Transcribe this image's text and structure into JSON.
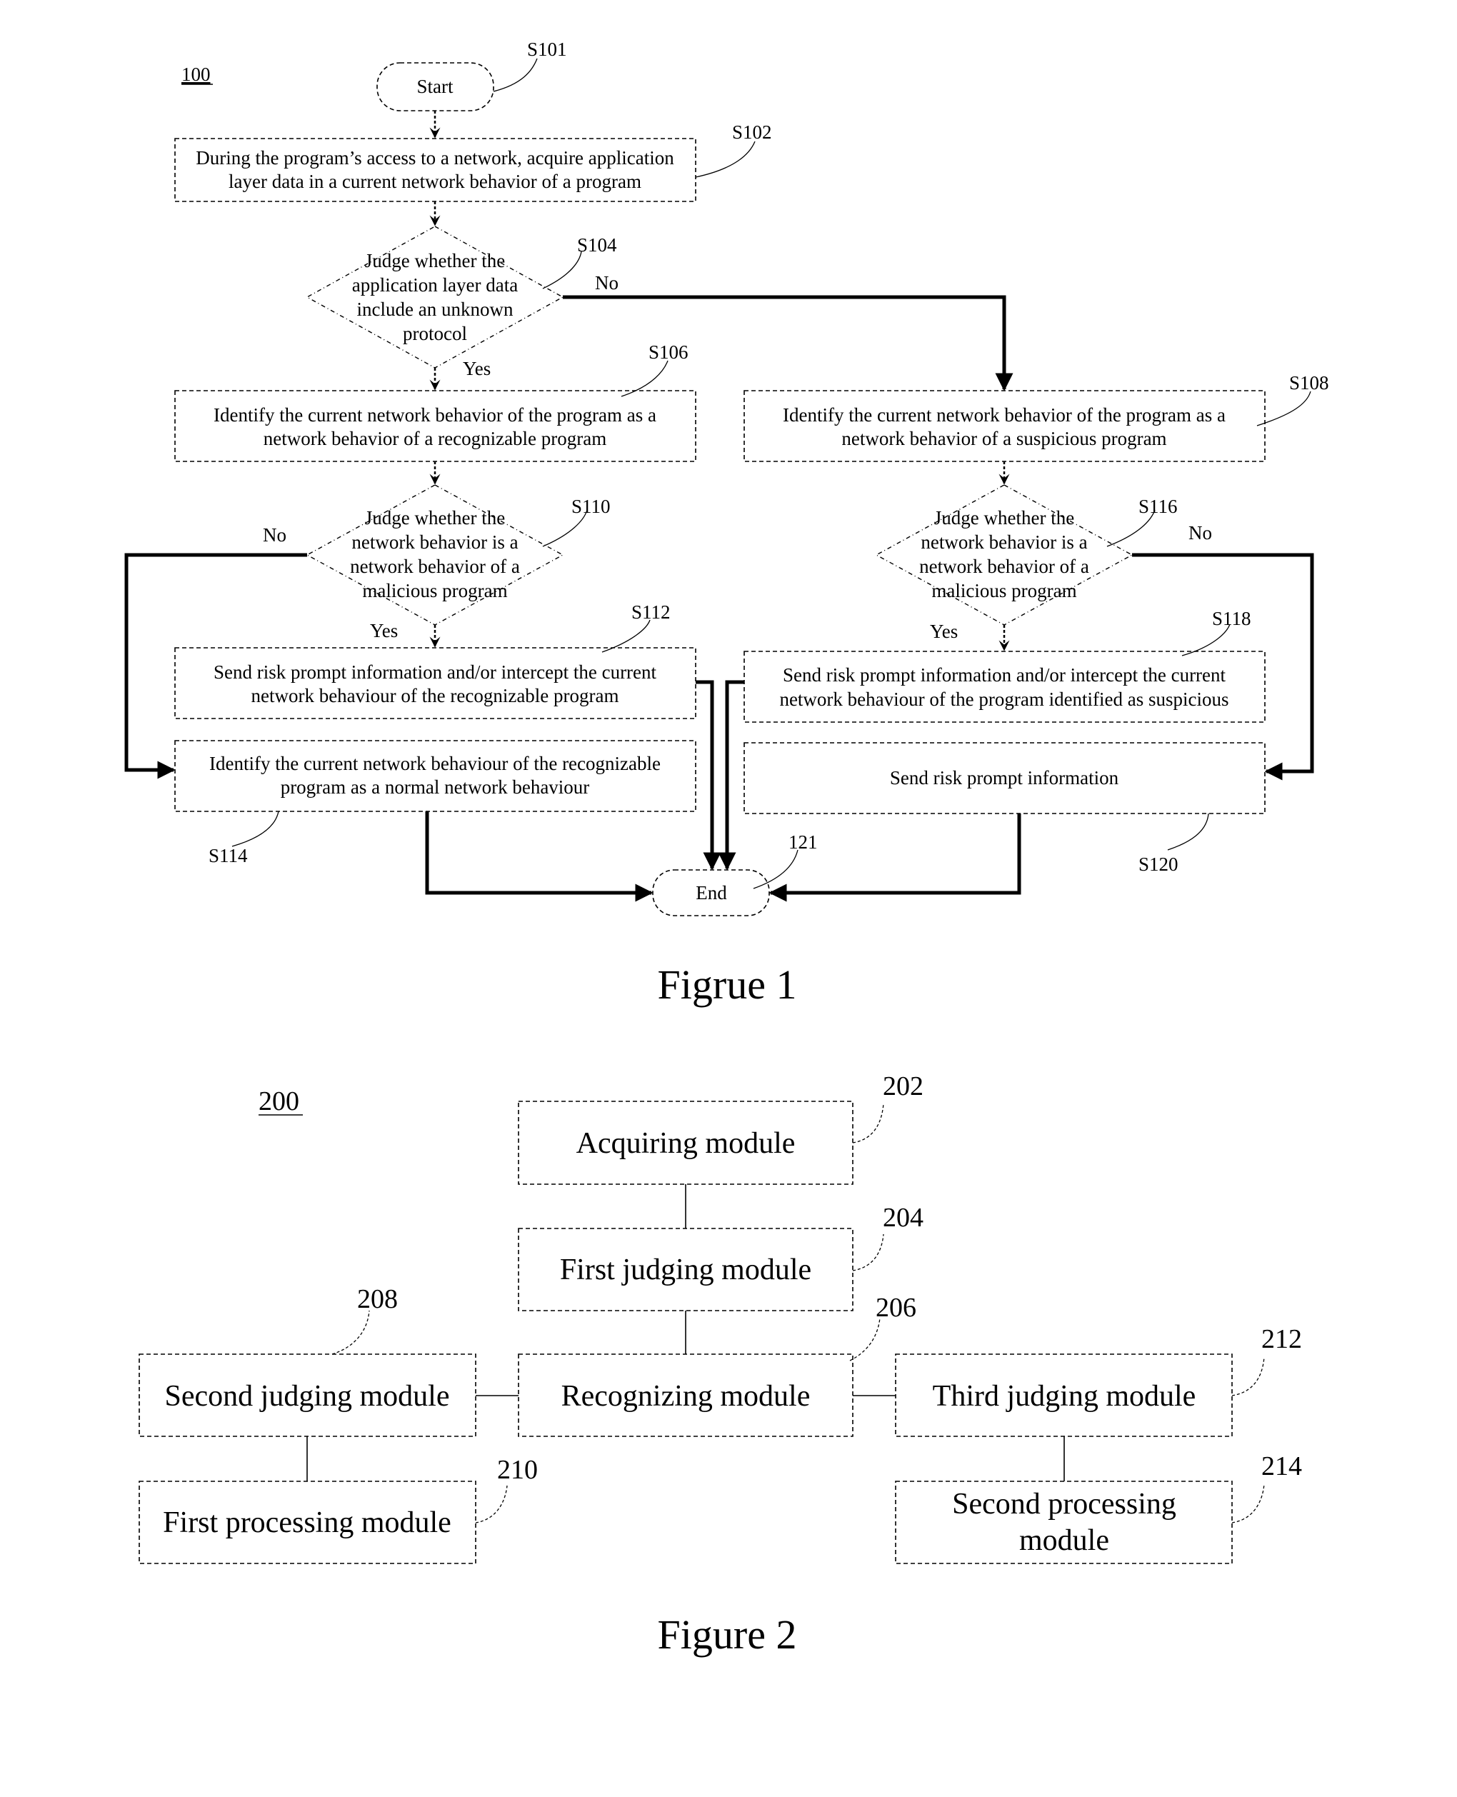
{
  "figure1": {
    "ref": "100",
    "caption": "Figrue 1",
    "start": {
      "label": "Start",
      "step": "S101"
    },
    "s102": {
      "step": "S102",
      "lines": [
        "During the program’s access to a network, acquire application",
        "layer data in a current network behavior of a program"
      ]
    },
    "s104": {
      "step": "S104",
      "lines": [
        "Judge whether the",
        "application layer data",
        "include an unknown",
        "protocol"
      ],
      "yes": "Yes",
      "no": "No"
    },
    "s106": {
      "step": "S106",
      "lines": [
        "Identify the current network behavior of the program as a",
        "network behavior of a recognizable program"
      ]
    },
    "s108": {
      "step": "S108",
      "lines": [
        "Identify the current network behavior of the program as a",
        "network behavior of a suspicious program"
      ]
    },
    "s110": {
      "step": "S110",
      "lines": [
        "Judge whether the",
        "network behavior is a",
        "network behavior of a",
        "malicious program"
      ],
      "yes": "Yes",
      "no": "No"
    },
    "s112": {
      "step": "S112",
      "lines": [
        "Send risk prompt information and/or intercept the current",
        "network behaviour of the recognizable program"
      ]
    },
    "s114": {
      "step": "S114",
      "lines": [
        "Identify the current network behaviour of the recognizable",
        "program as a normal network behaviour"
      ]
    },
    "s116": {
      "step": "S116",
      "lines": [
        "Judge whether the",
        "network behavior is a",
        "network behavior of a",
        "malicious program"
      ],
      "yes": "Yes",
      "no": "No"
    },
    "s118": {
      "step": "S118",
      "lines": [
        "Send risk prompt information and/or intercept the current",
        "network behaviour of the program identified as suspicious"
      ]
    },
    "s120": {
      "step": "S120",
      "lines": [
        "Send risk prompt information"
      ]
    },
    "end": {
      "label": "End",
      "step": "121"
    }
  },
  "figure2": {
    "ref": "200",
    "caption": "Figure 2",
    "modules": {
      "acquiring": {
        "num": "202",
        "lines": [
          "Acquiring module"
        ]
      },
      "first_judging": {
        "num": "204",
        "lines": [
          "First judging module"
        ]
      },
      "recognizing": {
        "num": "206",
        "lines": [
          "Recognizing module"
        ]
      },
      "second_judging": {
        "num": "208",
        "lines": [
          "Second judging module"
        ]
      },
      "first_processing": {
        "num": "210",
        "lines": [
          "First processing module"
        ]
      },
      "third_judging": {
        "num": "212",
        "lines": [
          "Third judging module"
        ]
      },
      "second_processing": {
        "num": "214",
        "lines": [
          "Second processing",
          "module"
        ]
      }
    }
  }
}
